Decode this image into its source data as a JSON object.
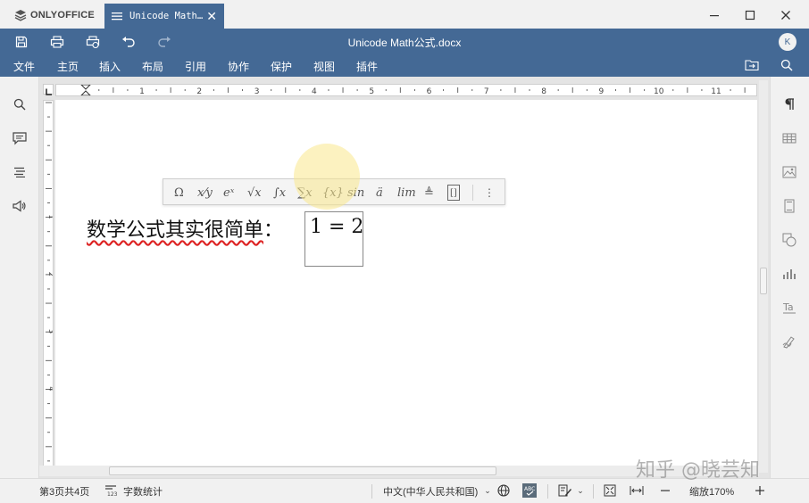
{
  "app": {
    "brand": "ONLYOFFICE"
  },
  "tab": {
    "label": "Unicode Math…"
  },
  "header": {
    "doc_title": "Unicode Math公式.docx",
    "avatar_initial": "K"
  },
  "menu": {
    "items": [
      "文件",
      "主页",
      "插入",
      "布局",
      "引用",
      "协作",
      "保护",
      "视图",
      "插件"
    ]
  },
  "ruler": {
    "h_labels": [
      "1",
      "2",
      "3",
      "4",
      "5",
      "6",
      "7",
      "8",
      "9",
      "10",
      "11"
    ],
    "v_labels": [
      "1",
      "2",
      "3",
      "4"
    ]
  },
  "equation_toolbar": {
    "buttons": [
      "Ω",
      "x⁄y",
      "eˣ",
      "√x",
      "∫x",
      "∑x",
      "{x}",
      "sin",
      "ä",
      "lim",
      "≜",
      "[]",
      "⋮"
    ]
  },
  "document": {
    "text": "数学公式其实很简单",
    "colon": "：",
    "equation": "1 = 2"
  },
  "status": {
    "page_info": "第3页共4页",
    "word_count": "字数统计",
    "language": "中文(中华人民共和国)",
    "zoom": "缩放170%"
  },
  "watermark": "知乎 @晓芸知",
  "colors": {
    "accent": "#446995",
    "spellcheck": "#d22222"
  }
}
